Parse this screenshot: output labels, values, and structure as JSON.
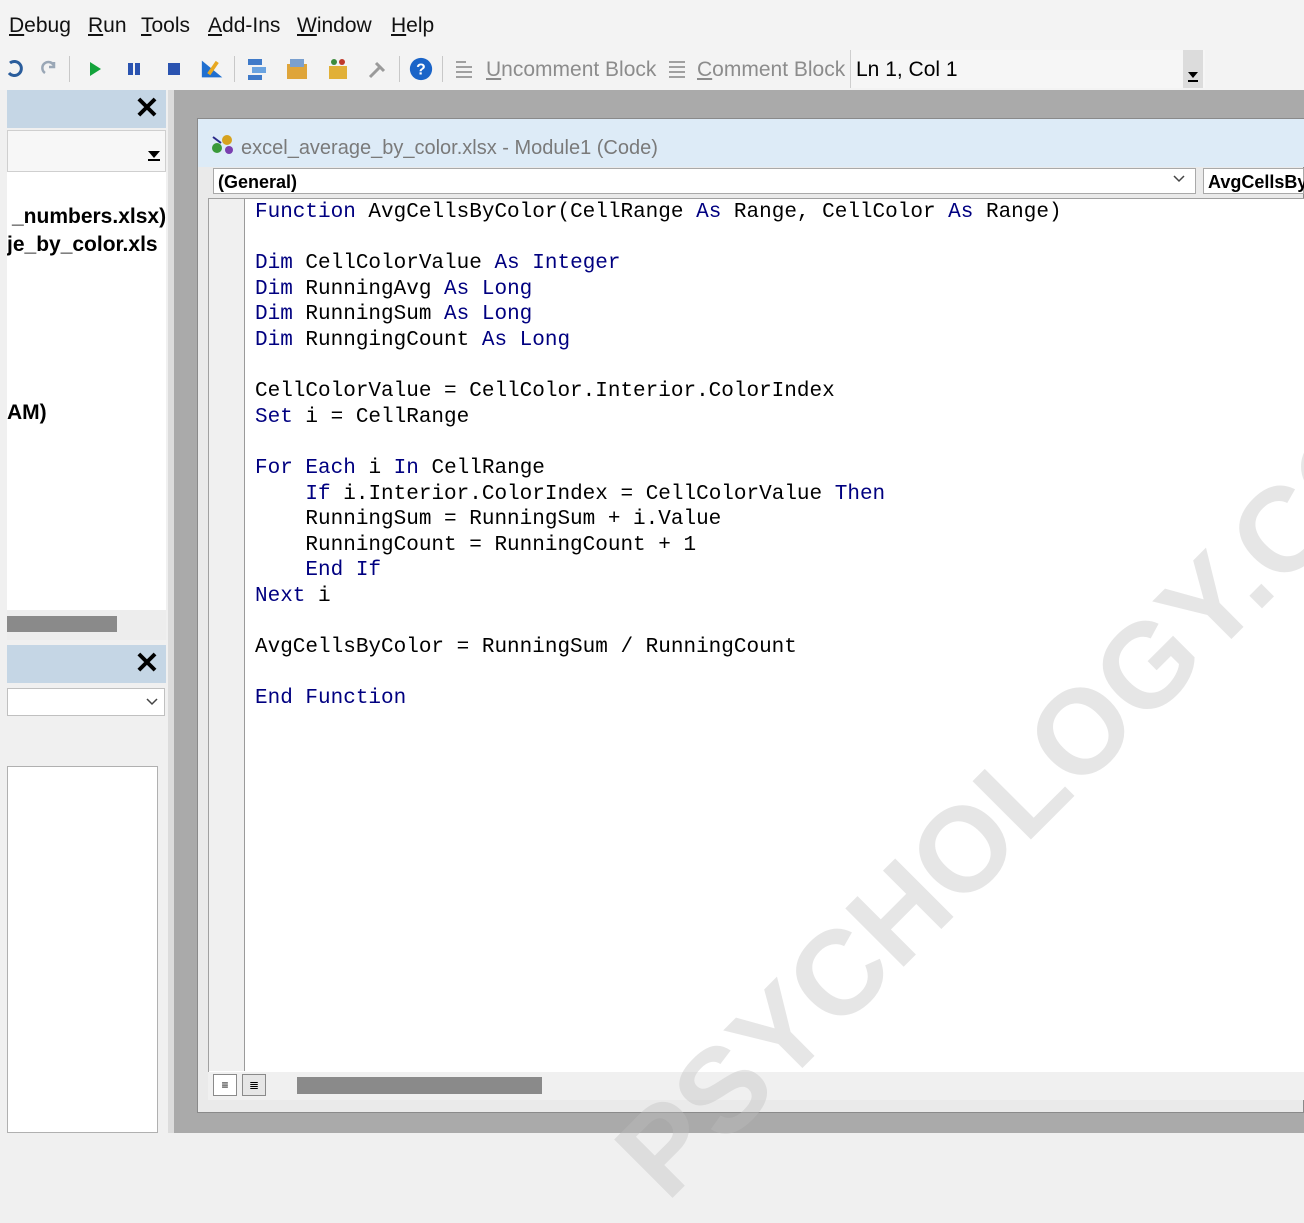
{
  "menubar": {
    "items": [
      {
        "accel": "D",
        "rest": "ebug"
      },
      {
        "accel": "R",
        "rest": "un"
      },
      {
        "accel": "T",
        "rest": "ools"
      },
      {
        "accel": "A",
        "rest": "dd-Ins"
      },
      {
        "accel": "W",
        "rest": "indow"
      },
      {
        "accel": "H",
        "rest": "elp"
      }
    ]
  },
  "toolbar": {
    "uncomment_accel": "U",
    "uncomment_rest": "ncomment Block",
    "comment_accel": "C",
    "comment_rest": "omment Block",
    "position": "Ln 1, Col 1"
  },
  "project_explorer": {
    "close_glyph": "✕",
    "items": [
      "_numbers.xlsx)",
      "je_by_color.xls",
      "AM)"
    ]
  },
  "properties": {
    "close_glyph": "✕"
  },
  "code_window": {
    "title": "excel_average_by_color.xlsx - Module1 (Code)",
    "object_combo": "(General)",
    "procedure_combo": "AvgCellsByColor",
    "view_proc_glyph": "≡",
    "view_full_glyph": "≣",
    "lines": [
      [
        {
          "t": "Function",
          "k": true
        },
        {
          "t": " AvgCellsByColor(CellRange "
        },
        {
          "t": "As",
          "k": true
        },
        {
          "t": " Range, CellColor "
        },
        {
          "t": "As",
          "k": true
        },
        {
          "t": " Range)"
        }
      ],
      [],
      [
        {
          "t": "Dim",
          "k": true
        },
        {
          "t": " CellColorValue "
        },
        {
          "t": "As",
          "k": true
        },
        {
          "t": " "
        },
        {
          "t": "Integer",
          "k": true
        }
      ],
      [
        {
          "t": "Dim",
          "k": true
        },
        {
          "t": " RunningAvg "
        },
        {
          "t": "As",
          "k": true
        },
        {
          "t": " "
        },
        {
          "t": "Long",
          "k": true
        }
      ],
      [
        {
          "t": "Dim",
          "k": true
        },
        {
          "t": " RunningSum "
        },
        {
          "t": "As",
          "k": true
        },
        {
          "t": " "
        },
        {
          "t": "Long",
          "k": true
        }
      ],
      [
        {
          "t": "Dim",
          "k": true
        },
        {
          "t": " RunngingCount "
        },
        {
          "t": "As",
          "k": true
        },
        {
          "t": " "
        },
        {
          "t": "Long",
          "k": true
        }
      ],
      [],
      [
        {
          "t": "CellColorValue = CellColor.Interior.ColorIndex"
        }
      ],
      [
        {
          "t": "Set",
          "k": true
        },
        {
          "t": " i = CellRange"
        }
      ],
      [],
      [
        {
          "t": "For",
          "k": true
        },
        {
          "t": " "
        },
        {
          "t": "Each",
          "k": true
        },
        {
          "t": " i "
        },
        {
          "t": "In",
          "k": true
        },
        {
          "t": " CellRange"
        }
      ],
      [
        {
          "t": "    "
        },
        {
          "t": "If",
          "k": true
        },
        {
          "t": " i.Interior.ColorIndex = CellColorValue "
        },
        {
          "t": "Then",
          "k": true
        }
      ],
      [
        {
          "t": "    RunningSum = RunningSum + i.Value"
        }
      ],
      [
        {
          "t": "    RunningCount = RunningCount + 1"
        }
      ],
      [
        {
          "t": "    "
        },
        {
          "t": "End",
          "k": true
        },
        {
          "t": " "
        },
        {
          "t": "If",
          "k": true
        }
      ],
      [
        {
          "t": "Next",
          "k": true
        },
        {
          "t": " i"
        }
      ],
      [],
      [
        {
          "t": "AvgCellsByColor = RunningSum / RunningCount"
        }
      ],
      [],
      [
        {
          "t": "End",
          "k": true
        },
        {
          "t": " "
        },
        {
          "t": "Function",
          "k": true
        }
      ]
    ]
  },
  "watermark": "PSYCHOLOGY.COM",
  "colors": {
    "keyword": "#000080",
    "title_bar_active": "#ddebf7",
    "panel_title": "#c5d6e5",
    "mdi_background": "#aaaaaa"
  }
}
